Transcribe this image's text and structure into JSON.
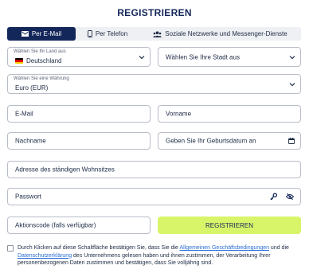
{
  "title": "REGISTRIEREN",
  "tabs": [
    {
      "label": "Per E-Mail",
      "icon": "envelope-icon",
      "active": true
    },
    {
      "label": "Per Telefon",
      "icon": "phone-icon",
      "active": false
    },
    {
      "label": "Soziale Netzwerke und Messenger-Dienste",
      "icon": "users-icon",
      "active": false
    }
  ],
  "country": {
    "label": "Wählen Sie Ihr Land aus",
    "value": "Deutschland"
  },
  "city": {
    "placeholder": "Wählen Sie Ihre Stadt aus"
  },
  "currency": {
    "label": "Wählen Sie eine Währung",
    "value": "Euro (EUR)"
  },
  "email": {
    "placeholder": "E-Mail"
  },
  "firstname": {
    "placeholder": "Vorname"
  },
  "lastname": {
    "placeholder": "Nachname"
  },
  "birthdate": {
    "placeholder": "Geben Sie Ihr Geburtsdatum an"
  },
  "address": {
    "placeholder": "Adresse des ständigen Wohnsitzes"
  },
  "password": {
    "placeholder": "Passwort"
  },
  "promo": {
    "placeholder": "Aktionscode (falls verfügbar)"
  },
  "submit_label": "REGISTRIEREN",
  "consent": {
    "part1": "Durch Klicken auf diese Schaltfläche bestätigen Sie, dass Sie die ",
    "link1": "Allgemeinen Geschäftsbedingungen",
    "part2": " und die ",
    "link2": "Datenschutzerklärung",
    "part3": " des Unternehmens gelesen haben und ihnen zustimmen, der Verarbeitung Ihrer personenbezogenen Daten zustimmen und bestätigen, dass Sie volljährig sind."
  },
  "colors": {
    "brand": "#14275a",
    "accent": "#d8f56a",
    "link": "#2a6fd6"
  }
}
